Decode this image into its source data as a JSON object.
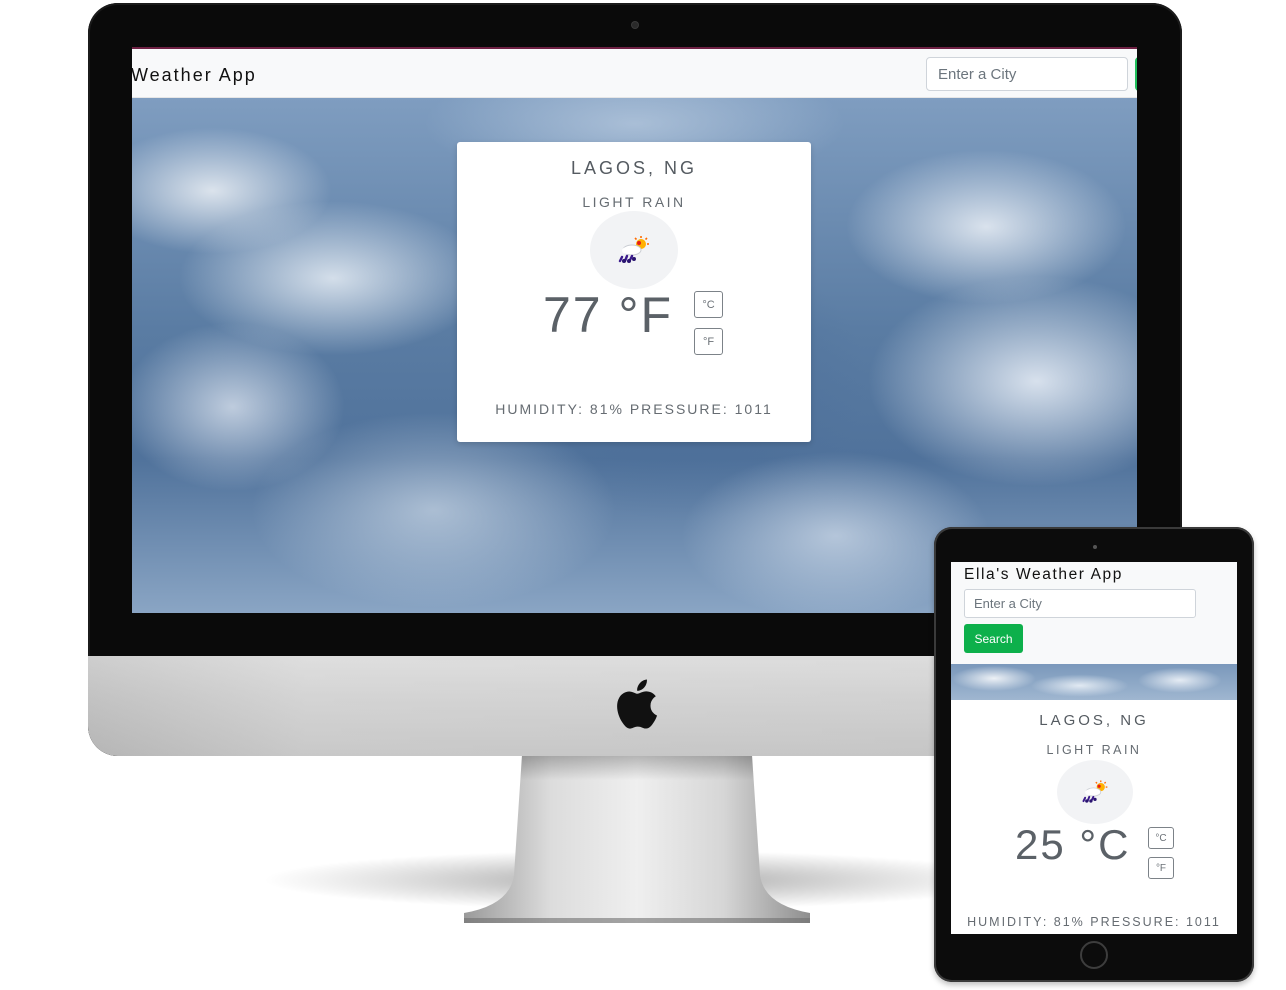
{
  "desktop": {
    "brand": "Weather App",
    "search": {
      "placeholder": "Enter a City"
    },
    "card": {
      "city": "LAGOS, NG",
      "description": "LIGHT RAIN",
      "temperature": "77 °F",
      "celsius_label": "°C",
      "fahrenheit_label": "°F",
      "stats": "HUMIDITY: 81% PRESSURE: 1011",
      "icon": "rain-cloud-sun-icon"
    }
  },
  "tablet": {
    "brand": "Ella's Weather App",
    "search": {
      "placeholder": "Enter a City",
      "button_label": "Search"
    },
    "card": {
      "city": "LAGOS, NG",
      "description": "LIGHT RAIN",
      "temperature": "25 °C",
      "celsius_label": "°C",
      "fahrenheit_label": "°F",
      "stats": "HUMIDITY: 81% PRESSURE: 1011",
      "icon": "rain-cloud-sun-icon"
    }
  },
  "colors": {
    "accent_green": "#0db04b",
    "navbar_bg": "#f8f9fa",
    "text_gray": "#5b6167"
  }
}
